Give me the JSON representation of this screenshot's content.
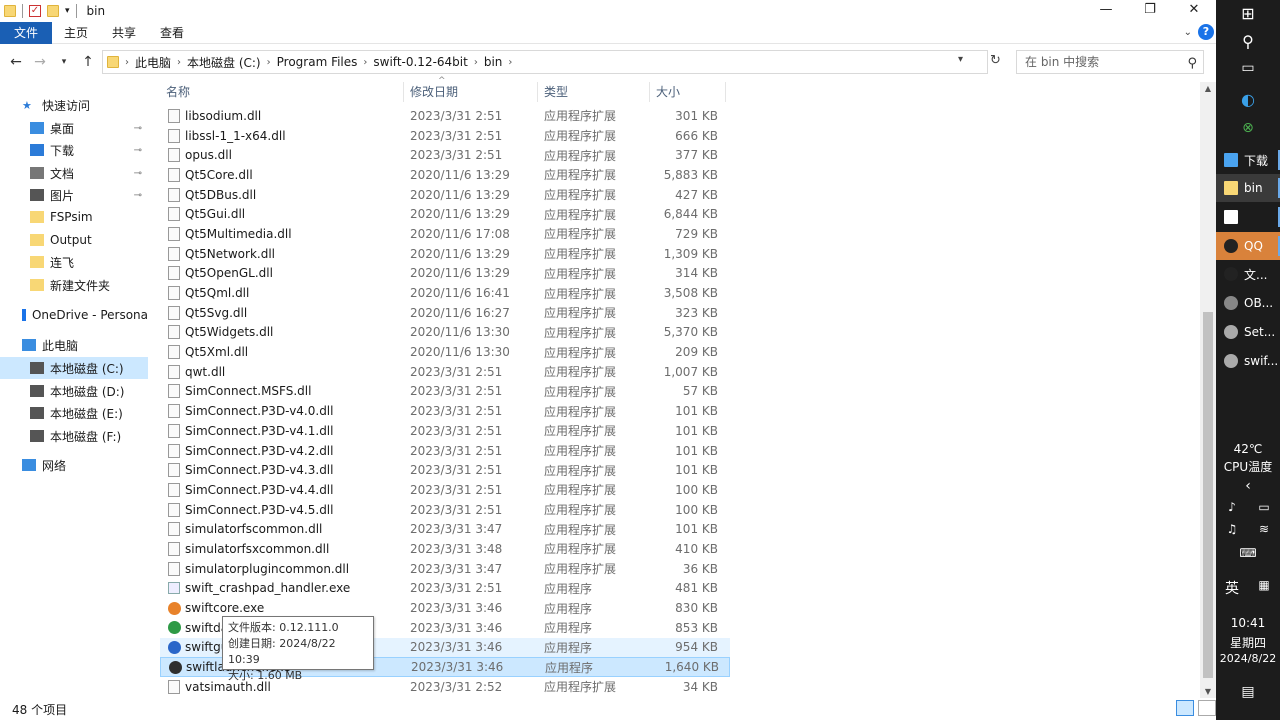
{
  "window": {
    "title": "bin",
    "controls": [
      "—",
      "❐",
      "✕"
    ]
  },
  "ribbon": {
    "tabs": [
      "文件",
      "主页",
      "共享",
      "查看"
    ],
    "help": "?"
  },
  "address": {
    "crumbs": [
      "此电脑",
      "本地磁盘 (C:)",
      "Program Files",
      "swift-0.12-64bit",
      "bin"
    ],
    "search_placeholder": "在 bin 中搜索"
  },
  "sidebar": {
    "items": [
      {
        "label": "快速访问",
        "icon": "star-icon",
        "level": 0
      },
      {
        "label": "桌面",
        "icon": "desktop-icon",
        "level": 1,
        "pinned": true
      },
      {
        "label": "下载",
        "icon": "download-icon",
        "level": 1,
        "pinned": true
      },
      {
        "label": "文档",
        "icon": "document-icon",
        "level": 1,
        "pinned": true
      },
      {
        "label": "图片",
        "icon": "picture-icon",
        "level": 1,
        "pinned": true
      },
      {
        "label": "FSPsim",
        "icon": "folder-icon",
        "level": 1
      },
      {
        "label": "Output",
        "icon": "folder-icon",
        "level": 1
      },
      {
        "label": "连飞",
        "icon": "folder-icon",
        "level": 1
      },
      {
        "label": "新建文件夹",
        "icon": "folder-icon",
        "level": 1
      },
      {
        "label": "OneDrive - Persona",
        "icon": "cloud-icon",
        "level": 0
      },
      {
        "label": "此电脑",
        "icon": "computer-icon",
        "level": 0
      },
      {
        "label": "本地磁盘 (C:)",
        "icon": "drive-icon",
        "level": 1,
        "selected": true
      },
      {
        "label": "本地磁盘 (D:)",
        "icon": "drive-icon",
        "level": 1
      },
      {
        "label": "本地磁盘 (E:)",
        "icon": "drive-icon",
        "level": 1
      },
      {
        "label": "本地磁盘 (F:)",
        "icon": "drive-icon",
        "level": 1
      },
      {
        "label": "网络",
        "icon": "network-icon",
        "level": 0
      }
    ]
  },
  "columns": {
    "name": "名称",
    "date": "修改日期",
    "type": "类型",
    "size": "大小"
  },
  "files": [
    {
      "name": "libsodium.dll",
      "date": "2023/3/31 2:51",
      "type": "应用程序扩展",
      "size": "301 KB",
      "icon": "dll"
    },
    {
      "name": "libssl-1_1-x64.dll",
      "date": "2023/3/31 2:51",
      "type": "应用程序扩展",
      "size": "666 KB",
      "icon": "dll"
    },
    {
      "name": "opus.dll",
      "date": "2023/3/31 2:51",
      "type": "应用程序扩展",
      "size": "377 KB",
      "icon": "dll"
    },
    {
      "name": "Qt5Core.dll",
      "date": "2020/11/6 13:29",
      "type": "应用程序扩展",
      "size": "5,883 KB",
      "icon": "dll"
    },
    {
      "name": "Qt5DBus.dll",
      "date": "2020/11/6 13:29",
      "type": "应用程序扩展",
      "size": "427 KB",
      "icon": "dll"
    },
    {
      "name": "Qt5Gui.dll",
      "date": "2020/11/6 13:29",
      "type": "应用程序扩展",
      "size": "6,844 KB",
      "icon": "dll"
    },
    {
      "name": "Qt5Multimedia.dll",
      "date": "2020/11/6 17:08",
      "type": "应用程序扩展",
      "size": "729 KB",
      "icon": "dll"
    },
    {
      "name": "Qt5Network.dll",
      "date": "2020/11/6 13:29",
      "type": "应用程序扩展",
      "size": "1,309 KB",
      "icon": "dll"
    },
    {
      "name": "Qt5OpenGL.dll",
      "date": "2020/11/6 13:29",
      "type": "应用程序扩展",
      "size": "314 KB",
      "icon": "dll"
    },
    {
      "name": "Qt5Qml.dll",
      "date": "2020/11/6 16:41",
      "type": "应用程序扩展",
      "size": "3,508 KB",
      "icon": "dll"
    },
    {
      "name": "Qt5Svg.dll",
      "date": "2020/11/6 16:27",
      "type": "应用程序扩展",
      "size": "323 KB",
      "icon": "dll"
    },
    {
      "name": "Qt5Widgets.dll",
      "date": "2020/11/6 13:30",
      "type": "应用程序扩展",
      "size": "5,370 KB",
      "icon": "dll"
    },
    {
      "name": "Qt5Xml.dll",
      "date": "2020/11/6 13:30",
      "type": "应用程序扩展",
      "size": "209 KB",
      "icon": "dll"
    },
    {
      "name": "qwt.dll",
      "date": "2023/3/31 2:51",
      "type": "应用程序扩展",
      "size": "1,007 KB",
      "icon": "dll"
    },
    {
      "name": "SimConnect.MSFS.dll",
      "date": "2023/3/31 2:51",
      "type": "应用程序扩展",
      "size": "57 KB",
      "icon": "dll"
    },
    {
      "name": "SimConnect.P3D-v4.0.dll",
      "date": "2023/3/31 2:51",
      "type": "应用程序扩展",
      "size": "101 KB",
      "icon": "dll"
    },
    {
      "name": "SimConnect.P3D-v4.1.dll",
      "date": "2023/3/31 2:51",
      "type": "应用程序扩展",
      "size": "101 KB",
      "icon": "dll"
    },
    {
      "name": "SimConnect.P3D-v4.2.dll",
      "date": "2023/3/31 2:51",
      "type": "应用程序扩展",
      "size": "101 KB",
      "icon": "dll"
    },
    {
      "name": "SimConnect.P3D-v4.3.dll",
      "date": "2023/3/31 2:51",
      "type": "应用程序扩展",
      "size": "101 KB",
      "icon": "dll"
    },
    {
      "name": "SimConnect.P3D-v4.4.dll",
      "date": "2023/3/31 2:51",
      "type": "应用程序扩展",
      "size": "100 KB",
      "icon": "dll"
    },
    {
      "name": "SimConnect.P3D-v4.5.dll",
      "date": "2023/3/31 2:51",
      "type": "应用程序扩展",
      "size": "100 KB",
      "icon": "dll"
    },
    {
      "name": "simulatorfscommon.dll",
      "date": "2023/3/31 3:47",
      "type": "应用程序扩展",
      "size": "101 KB",
      "icon": "dll"
    },
    {
      "name": "simulatorfsxcommon.dll",
      "date": "2023/3/31 3:48",
      "type": "应用程序扩展",
      "size": "410 KB",
      "icon": "dll"
    },
    {
      "name": "simulatorplugincommon.dll",
      "date": "2023/3/31 3:47",
      "type": "应用程序扩展",
      "size": "36 KB",
      "icon": "dll"
    },
    {
      "name": "swift_crashpad_handler.exe",
      "date": "2023/3/31 2:51",
      "type": "应用程序",
      "size": "481 KB",
      "icon": "exe"
    },
    {
      "name": "swiftcore.exe",
      "date": "2023/3/31 3:46",
      "type": "应用程序",
      "size": "830 KB",
      "icon": "orange"
    },
    {
      "name": "swiftda",
      "date": "2023/3/31 3:46",
      "type": "应用程序",
      "size": "853 KB",
      "icon": "green"
    },
    {
      "name": "swiftgu",
      "date": "2023/3/31 3:46",
      "type": "应用程序",
      "size": "954 KB",
      "icon": "blue",
      "state": "hover"
    },
    {
      "name": "swiftlauncher.exe",
      "date": "2023/3/31 3:46",
      "type": "应用程序",
      "size": "1,640 KB",
      "icon": "dark",
      "state": "selected"
    },
    {
      "name": "vatsimauth.dll",
      "date": "2023/3/31 2:52",
      "type": "应用程序扩展",
      "size": "34 KB",
      "icon": "dll"
    }
  ],
  "tooltip": {
    "line1": "文件版本: 0.12.111.0",
    "line2": "创建日期: 2024/8/22 10:39",
    "line3": "大小: 1.60 MB"
  },
  "status": {
    "count": "48 个项目"
  },
  "taskbar": {
    "items": [
      {
        "label": "下载",
        "icon": "download-icon"
      },
      {
        "label": "bin",
        "icon": "folder-icon",
        "active": true
      },
      {
        "label": "",
        "icon": "document-icon"
      },
      {
        "label": "QQ",
        "icon": "qq-icon",
        "highlight": true
      },
      {
        "label": "文...",
        "icon": "qq-icon"
      },
      {
        "label": "OB...",
        "icon": "obs-icon"
      },
      {
        "label": "Set...",
        "icon": "settings-icon"
      },
      {
        "label": "swif...",
        "icon": "swift-icon"
      }
    ],
    "temp": "42℃",
    "temp_label": "CPU温度",
    "ime": "英",
    "time": "10:41",
    "weekday": "星期四",
    "date": "2024/8/22"
  },
  "colors": {
    "accent": "#1a5fb4",
    "selected": "#cce8ff",
    "hover": "#e5f3ff",
    "taskbar": "#1c1c1c",
    "qq": "#d9823b"
  }
}
